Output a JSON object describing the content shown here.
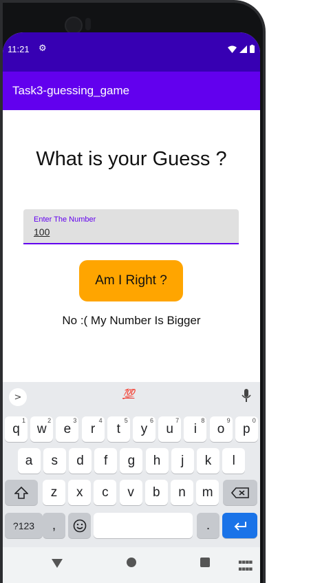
{
  "status_bar": {
    "time": "11:21",
    "background": "#3700b3"
  },
  "app_bar": {
    "title": "Task3-guessing_game",
    "background": "#6200ee"
  },
  "main": {
    "headline": "What is your Guess ?",
    "input": {
      "label": "Enter The Number",
      "value": "100"
    },
    "button": {
      "label": "Am I Right ?",
      "color": "#ffa500"
    },
    "result": "No :( My Number Is Bigger"
  },
  "keyboard": {
    "suggestion_emoji": "💯",
    "row1": [
      {
        "k": "q",
        "h": "1"
      },
      {
        "k": "w",
        "h": "2"
      },
      {
        "k": "e",
        "h": "3"
      },
      {
        "k": "r",
        "h": "4"
      },
      {
        "k": "t",
        "h": "5"
      },
      {
        "k": "y",
        "h": "6"
      },
      {
        "k": "u",
        "h": "7"
      },
      {
        "k": "i",
        "h": "8"
      },
      {
        "k": "o",
        "h": "9"
      },
      {
        "k": "p",
        "h": "0"
      }
    ],
    "row2": [
      "a",
      "s",
      "d",
      "f",
      "g",
      "h",
      "j",
      "k",
      "l"
    ],
    "row3": [
      "z",
      "x",
      "c",
      "v",
      "b",
      "n",
      "m"
    ],
    "symbols_label": "?123",
    "comma": ",",
    "period": ".",
    "enter_color": "#1a73e8"
  }
}
